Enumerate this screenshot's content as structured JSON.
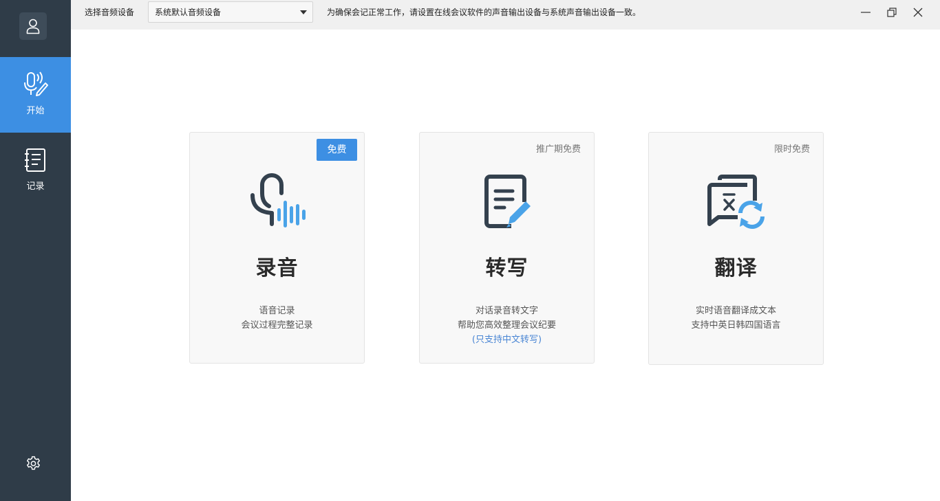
{
  "sidebar": {
    "items": [
      {
        "label": "开始",
        "icon": "microphone-pen-icon",
        "active": true
      },
      {
        "label": "记录",
        "icon": "notebook-icon",
        "active": false
      }
    ],
    "accent": "#3d8fe3",
    "background": "#2f3c48"
  },
  "topbar": {
    "device_label": "选择音频设备",
    "device_value": "系统默认音频设备",
    "notice": "为确保会记正常工作，请设置在线会议软件的声音输出设备与系统声音输出设备一致。"
  },
  "cards": [
    {
      "badge": "免费",
      "title": "录音",
      "desc": [
        "语音记录",
        "会议过程完整记录"
      ]
    },
    {
      "badge": "推广期免费",
      "title": "转写",
      "desc": [
        "对话录音转文字",
        "帮助您高效整理会议纪要"
      ],
      "note": "(只支持中文转写)"
    },
    {
      "badge": "限时免费",
      "title": "翻译",
      "desc": [
        "实时语音翻译成文本",
        "支持中英日韩四国语言"
      ]
    }
  ]
}
